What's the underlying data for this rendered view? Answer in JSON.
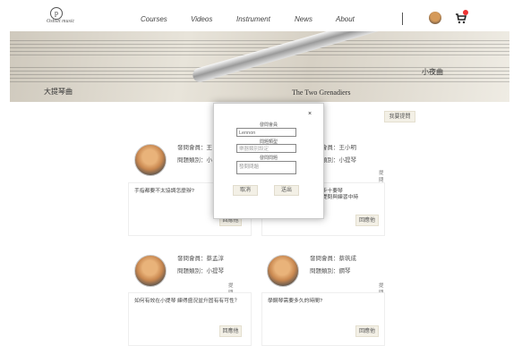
{
  "nav": {
    "logo_text": "Oshiet music",
    "links": [
      "Courses",
      "Videos",
      "Instrument",
      "News",
      "About"
    ],
    "cart_badge": "1"
  },
  "hero": {
    "labels": [
      "The Two Grenadiers",
      "大提琴曲",
      "小夜曲"
    ]
  },
  "actions": {
    "new_post_btn": "我要提問"
  },
  "posts": [
    {
      "author": "發問會員：王",
      "category": "問題類別：小",
      "tag": "提問",
      "question": "手指都要不太協調怎麼辦?",
      "reply_btn": "回應他"
    },
    {
      "author": "發問會員：王小明",
      "category": "問題類別：小提琴",
      "tag": "提問",
      "question": "琴一步十要琴\n正常提問與練習中時",
      "reply_btn": "回應他"
    },
    {
      "author": "發問會員：蔡孟淳",
      "category": "問題類別：小提琴",
      "tag": "提問",
      "question": "如何有效在小提琴 練得盛況盆升固有有可性？",
      "reply_btn": "回應他"
    },
    {
      "author": "發問會員：蔡筑成",
      "category": "問題類別：鋼琴",
      "tag": "提問",
      "question": "學鋼琴需要多久的時間?",
      "reply_btn": "回應他"
    }
  ],
  "modal": {
    "close": "×",
    "user_label": "發問會員",
    "user_value": "Lennon",
    "category_label": "問題類型",
    "category_placeholder": "樂器類別設定",
    "question_label": "發問問題",
    "question_placeholder": "發問問題",
    "cancel_btn": "取消",
    "submit_btn": "送出"
  }
}
